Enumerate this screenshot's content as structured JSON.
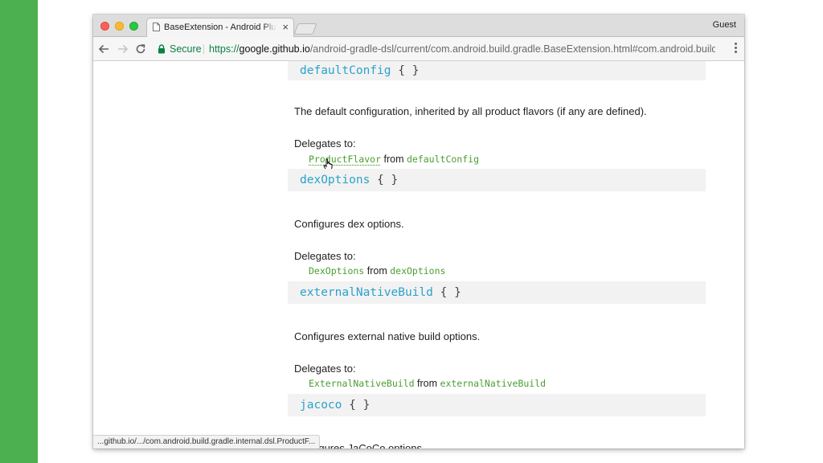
{
  "browser": {
    "tab_title": "BaseExtension - Android Plugin",
    "tab_close": "×",
    "profile": "Guest",
    "secure_label": "Secure",
    "url": {
      "scheme": "https://",
      "host": "google.github.io",
      "path": "/android-gradle-dsl/current/com.android.build.gradle.BaseExtension.html#com.android.build.g..."
    },
    "status_url": "...github.io/.../com.android.build.gradle.internal.dsl.ProductF..."
  },
  "sections": [
    {
      "name": "defaultConfig",
      "braces": "{ }",
      "description": "The default configuration, inherited by all product flavors (if any are defined).",
      "delegates_label": "Delegates to:",
      "type_link": "ProductFlavor",
      "from_word": "from",
      "source_link": "defaultConfig"
    },
    {
      "name": "dexOptions",
      "braces": "{ }",
      "description": "Configures dex options.",
      "delegates_label": "Delegates to:",
      "type_link": "DexOptions",
      "from_word": "from",
      "source_link": "dexOptions"
    },
    {
      "name": "externalNativeBuild",
      "braces": "{ }",
      "description": "Configures external native build options.",
      "delegates_label": "Delegates to:",
      "type_link": "ExternalNativeBuild",
      "from_word": "from",
      "source_link": "externalNativeBuild"
    },
    {
      "name": "jacoco",
      "braces": "{ }",
      "description": "Configures JaCoCo options."
    }
  ],
  "colors": {
    "accent_green": "#4caf50",
    "member_name": "#2aa3c9",
    "code_link": "#4a9e30",
    "secure_green": "#0b8043"
  },
  "icons": [
    "traffic-lights",
    "document-icon",
    "back-arrow-icon",
    "forward-arrow-icon",
    "reload-icon",
    "lock-icon",
    "more-vert-icon",
    "hand-cursor-icon"
  ]
}
